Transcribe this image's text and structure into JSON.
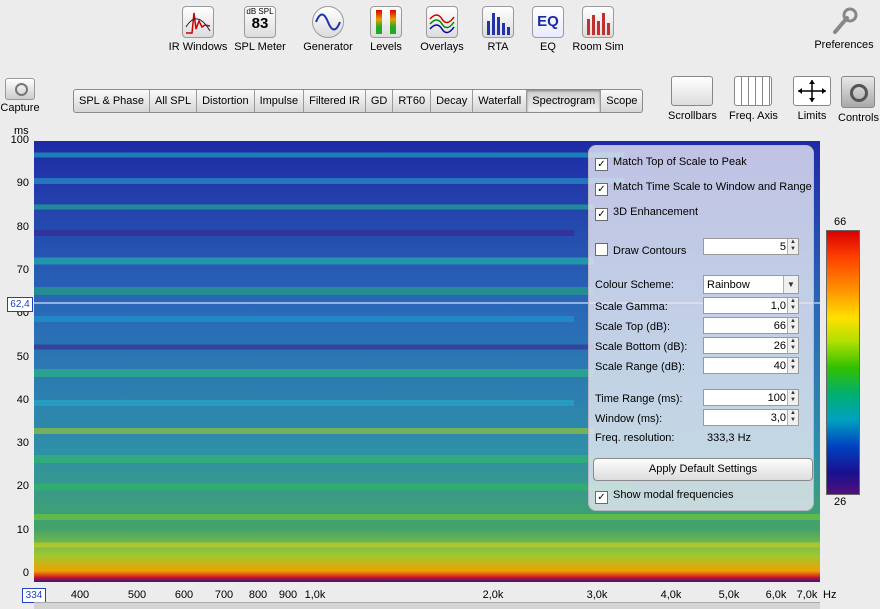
{
  "toolbar": {
    "items": [
      {
        "label": "IR Windows",
        "icon": "ir-windows-icon"
      },
      {
        "label": "SPL Meter",
        "icon": "spl-meter-icon",
        "badge_top": "dB SPL",
        "badge_value": "83"
      },
      {
        "label": "Generator",
        "icon": "generator-icon"
      },
      {
        "label": "Levels",
        "icon": "levels-icon"
      },
      {
        "label": "Overlays",
        "icon": "overlays-icon"
      },
      {
        "label": "RTA",
        "icon": "rta-icon"
      },
      {
        "label": "EQ",
        "icon": "eq-icon",
        "badge_value": "EQ"
      },
      {
        "label": "Room Sim",
        "icon": "room-sim-icon"
      }
    ],
    "preferences": "Preferences"
  },
  "capture": "Capture",
  "tabs": [
    "SPL & Phase",
    "All SPL",
    "Distortion",
    "Impulse",
    "Filtered IR",
    "GD",
    "RT60",
    "Decay",
    "Waterfall",
    "Spectrogram",
    "Scope"
  ],
  "active_tab": "Spectrogram",
  "right_tools": [
    "Scrollbars",
    "Freq. Axis",
    "Limits",
    "Controls"
  ],
  "plot": {
    "y_unit": "ms",
    "y_ticks": [
      "100",
      "90",
      "80",
      "70",
      "60",
      "50",
      "40",
      "30",
      "20",
      "10",
      "0"
    ],
    "cursor_y": "62,4",
    "cursor_x": "334",
    "x_unit": "Hz",
    "x_ticks": [
      "400",
      "500",
      "600",
      "700",
      "800",
      "900",
      "1,0k",
      "2,0k",
      "3,0k",
      "4,0k",
      "5,0k",
      "6,0k",
      "7,0k"
    ],
    "colorbar_top": "66",
    "colorbar_bottom": "26"
  },
  "controls": {
    "match_top": "Match Top of Scale to Peak",
    "match_time": "Match Time Scale to Window and Range",
    "enhancement": "3D Enhancement",
    "draw_contours": "Draw Contours",
    "contours_value": "5",
    "colour_scheme_label": "Colour Scheme:",
    "colour_scheme_value": "Rainbow",
    "scale_gamma_label": "Scale Gamma:",
    "scale_gamma_value": "1,0",
    "scale_top_label": "Scale Top (dB):",
    "scale_top_value": "66",
    "scale_bottom_label": "Scale Bottom (dB):",
    "scale_bottom_value": "26",
    "scale_range_label": "Scale Range (dB):",
    "scale_range_value": "40",
    "time_range_label": "Time Range (ms):",
    "time_range_value": "100",
    "window_label": "Window (ms):",
    "window_value": "3,0",
    "freq_res_label": "Freq. resolution:",
    "freq_res_value": "333,3 Hz",
    "apply_default": "Apply Default Settings",
    "show_modal": "Show modal frequencies",
    "checked": {
      "match_top": true,
      "match_time": true,
      "enhancement": true,
      "draw_contours": false,
      "show_modal": true
    }
  }
}
